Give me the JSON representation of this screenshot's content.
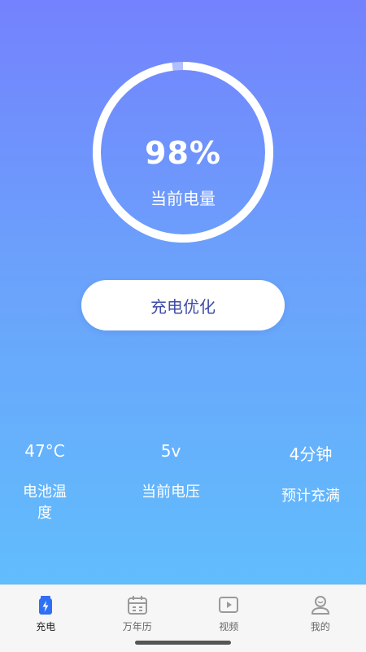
{
  "battery": {
    "percent_text": "98%",
    "percent_value": 0.98,
    "label": "当前电量"
  },
  "optimize_button": {
    "label": "充电优化"
  },
  "stats": [
    {
      "value": "47°C",
      "label": "电池温度"
    },
    {
      "value": "5v",
      "label": "当前电压"
    },
    {
      "value": "4分钟",
      "label": "预计充满"
    }
  ],
  "nav": {
    "items": [
      {
        "label": "充电",
        "icon": "battery-charging-icon",
        "active": true
      },
      {
        "label": "万年历",
        "icon": "calendar-icon",
        "active": false
      },
      {
        "label": "视频",
        "icon": "play-video-icon",
        "active": false
      },
      {
        "label": "我的",
        "icon": "user-icon",
        "active": false
      }
    ]
  },
  "colors": {
    "accent": "#3f4ca8",
    "active_icon": "#2f6ff5",
    "gradient_top": "#7482fd",
    "gradient_bottom": "#5fc3fd"
  }
}
